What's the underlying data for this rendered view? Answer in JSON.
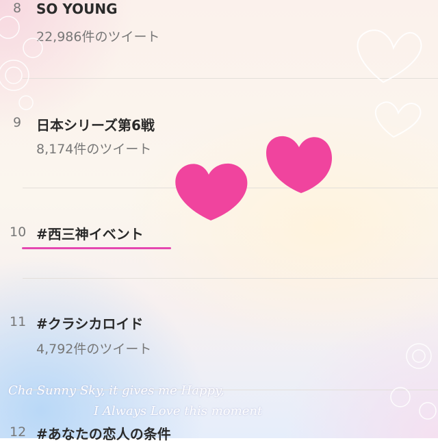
{
  "trends": [
    {
      "rank": "8",
      "title": "SO YOUNG",
      "count": "22,986件のツイート"
    },
    {
      "rank": "9",
      "title": "日本シリーズ第6戦",
      "count": "8,174件のツイート"
    },
    {
      "rank": "10",
      "title": "#西三神イベント",
      "count": ""
    },
    {
      "rank": "11",
      "title": "#クラシカロイド",
      "count": "4,792件のツイート"
    },
    {
      "rank": "12",
      "title": "#あなたの恋人の条件",
      "count": ""
    }
  ],
  "decoration": {
    "line1": "Cha Sunny Sky, it gives me Happy,",
    "line2": "I Always Love this moment"
  },
  "colors": {
    "heart": "#f0449e",
    "underline": "#e447b0"
  }
}
